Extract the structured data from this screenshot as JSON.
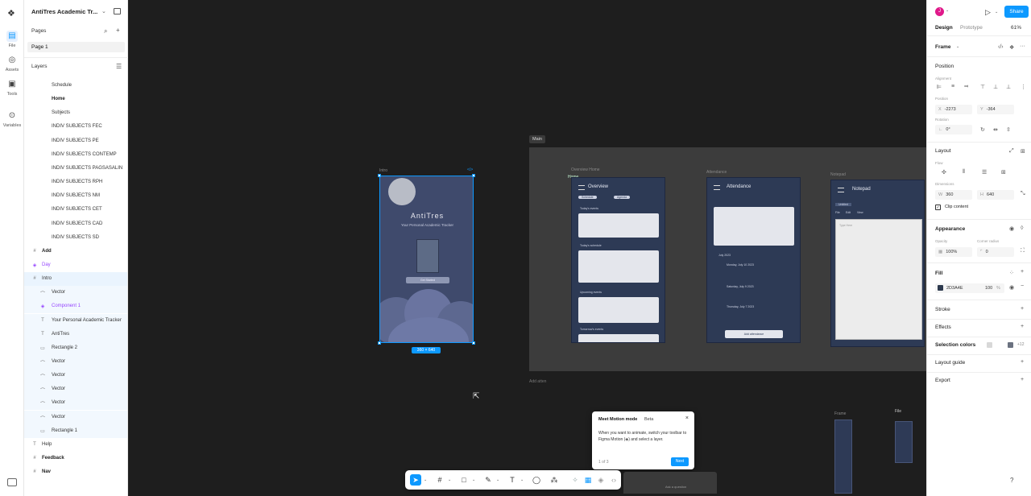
{
  "rail": {
    "items": [
      {
        "label": "File"
      },
      {
        "label": "Assets"
      },
      {
        "label": "Tools"
      },
      {
        "label": "Variables"
      }
    ]
  },
  "left_panel": {
    "file_title": "AntiTres Academic Tr...",
    "pages_title": "Pages",
    "current_page": "Page 1",
    "layers_title": "Layers",
    "layers": [
      {
        "name": "Schedule",
        "indent": 2,
        "icon": "",
        "style": ""
      },
      {
        "name": "Home",
        "indent": 2,
        "icon": "",
        "style": "bold"
      },
      {
        "name": "Subjects",
        "indent": 2,
        "icon": "",
        "style": ""
      },
      {
        "name": "INDIV SUBJECTS FEC",
        "indent": 2,
        "icon": "",
        "style": ""
      },
      {
        "name": "INDIV SUBJECTS PE",
        "indent": 2,
        "icon": "",
        "style": ""
      },
      {
        "name": "INDIV SUBJECTS CONTEMP",
        "indent": 2,
        "icon": "",
        "style": ""
      },
      {
        "name": "INDIV SUBJECTS PAGSASALIN",
        "indent": 2,
        "icon": "",
        "style": ""
      },
      {
        "name": "INDIV SUBJECTS RPH",
        "indent": 2,
        "icon": "",
        "style": ""
      },
      {
        "name": "INDIV SUBJECTS NM",
        "indent": 2,
        "icon": "",
        "style": ""
      },
      {
        "name": "INDIV SUBJECTS CET",
        "indent": 2,
        "icon": "",
        "style": ""
      },
      {
        "name": "INDIV SUBJECTS CAD",
        "indent": 2,
        "icon": "",
        "style": ""
      },
      {
        "name": "INDIV SUBJECTS SD",
        "indent": 2,
        "icon": "",
        "style": ""
      },
      {
        "name": "Add",
        "indent": 1,
        "icon": "#",
        "style": "bold"
      },
      {
        "name": "Day",
        "indent": 1,
        "icon": "◈",
        "style": "purple"
      },
      {
        "name": "Intro",
        "indent": 1,
        "icon": "#",
        "style": "sel"
      },
      {
        "name": "Vector",
        "indent": 2,
        "icon": "⌒",
        "style": "child"
      },
      {
        "name": "Component 1",
        "indent": 2,
        "icon": "◈",
        "style": "child purple"
      },
      {
        "name": "Your Personal Academic Tracker",
        "indent": 2,
        "icon": "T",
        "style": "child"
      },
      {
        "name": "AntiTres",
        "indent": 2,
        "icon": "T",
        "style": "child"
      },
      {
        "name": "Rectangle 2",
        "indent": 2,
        "icon": "▭",
        "style": "child"
      },
      {
        "name": "Vector",
        "indent": 2,
        "icon": "⌒",
        "style": "child"
      },
      {
        "name": "Vector",
        "indent": 2,
        "icon": "⌒",
        "style": "child"
      },
      {
        "name": "Vector",
        "indent": 2,
        "icon": "⌒",
        "style": "child"
      },
      {
        "name": "Vector",
        "indent": 2,
        "icon": "⌒",
        "style": "child"
      },
      {
        "name": "Vector",
        "indent": 2,
        "icon": "⌒",
        "style": "child"
      },
      {
        "name": "Rectangle 1",
        "indent": 2,
        "icon": "▭",
        "style": "child"
      },
      {
        "name": "Help",
        "indent": 1,
        "icon": "T",
        "style": ""
      },
      {
        "name": "Feedback",
        "indent": 1,
        "icon": "#",
        "style": "bold"
      },
      {
        "name": "Nav",
        "indent": 1,
        "icon": "#",
        "style": "bold"
      }
    ]
  },
  "canvas": {
    "intro_label": "Intro",
    "intro_app_title": "AntiTres",
    "intro_app_subtitle": "Your Personal Academic Tracker",
    "intro_button": "Get Started",
    "size_badge": "360 × 640",
    "main_label": "Main",
    "frames": [
      {
        "label": "Overview Home",
        "title": "Overview"
      },
      {
        "label": "Attendance",
        "title": "Attendance"
      },
      {
        "label": "Notepad",
        "title": "Notepad"
      }
    ],
    "home_label": "Home",
    "overview_tabs": [
      "Schedule",
      "Agenda"
    ],
    "overview_sections": [
      "Today's events",
      "Today's schedule",
      "Upcoming events",
      "Tomorrow's events"
    ],
    "attendance_month": "July 2023",
    "attendance_items": [
      "Monday, July 10 2023",
      "Saturday, July 9 2023",
      "Thursday, July 7 2023"
    ],
    "attendance_button": "Add attendance",
    "notepad_tab": "Untitled",
    "notepad_menu": [
      "File",
      "Edit",
      "View"
    ],
    "notepad_placeholder": "Type Here",
    "add_atten_label": "Add atten",
    "mini_frame_label": "Frame",
    "mini_file_label": "File",
    "bottom_pill_text": "Ask a question"
  },
  "tooltip": {
    "title": "Meet Motion mode",
    "badge": "Beta",
    "body": "When you want to animate, switch your toolbar to Figma Motion (◈) and select a layer.",
    "step": "1 of 3",
    "next": "Next"
  },
  "right_panel": {
    "avatar_initial": "J",
    "share": "Share",
    "tab_design": "Design",
    "tab_prototype": "Prototype",
    "zoom": "61%",
    "frame_title": "Frame",
    "position_title": "Position",
    "alignment_label": "Alignment",
    "position_label": "Position",
    "x_label": "X",
    "x_value": "-2273",
    "y_label": "Y",
    "y_value": "-364",
    "rotation_label": "Rotation",
    "rotation_value": "0°",
    "layout_title": "Layout",
    "flow_label": "Flow",
    "dimensions_label": "Dimensions",
    "w_label": "W",
    "w_value": "360",
    "h_label": "H",
    "h_value": "640",
    "clip_content": "Clip content",
    "appearance_title": "Appearance",
    "opacity_label": "Opacity",
    "opacity_value": "100%",
    "radius_label": "Corner radius",
    "radius_value": "0",
    "fill_title": "Fill",
    "fill_hex": "2D3A4E",
    "fill_opacity": "100",
    "fill_unit": "%",
    "fill_color": "#2D3A4E",
    "stroke_title": "Stroke",
    "effects_title": "Effects",
    "selection_colors_title": "Selection colors",
    "selection_colors_more": "+12",
    "layout_guide_title": "Layout guide",
    "export_title": "Export"
  }
}
